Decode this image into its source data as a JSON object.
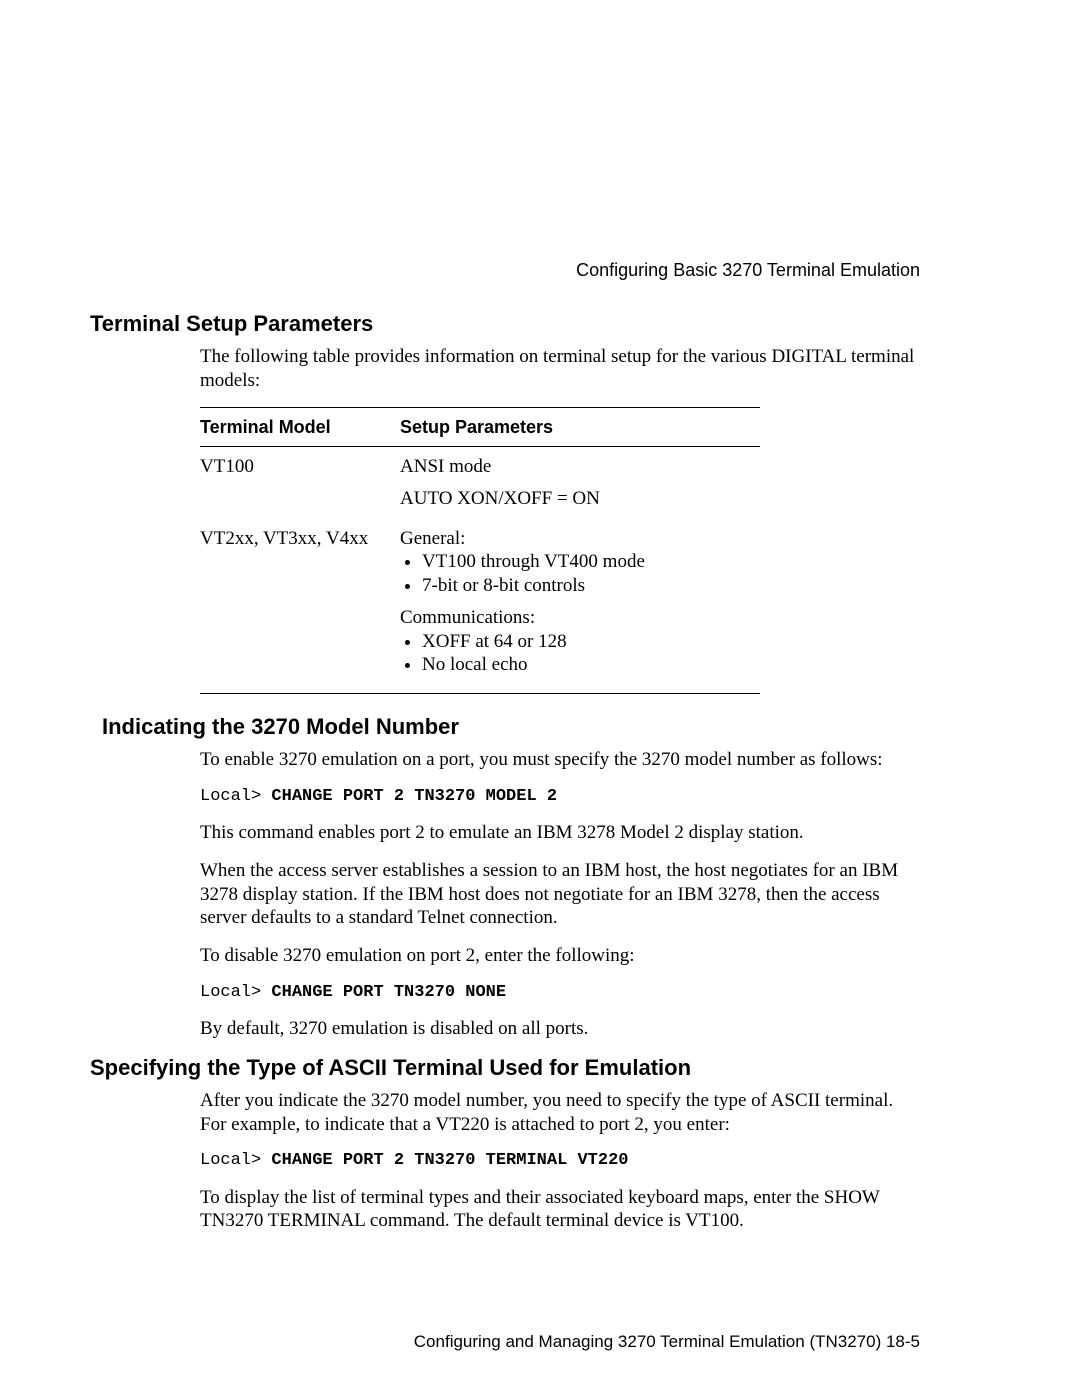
{
  "running_head": "Configuring Basic 3270 Terminal Emulation",
  "sections": {
    "setup": {
      "title": "Terminal Setup Parameters",
      "intro": "The following table provides information on terminal setup for the various DIGITAL terminal models:",
      "table": {
        "headers": {
          "model": "Terminal Model",
          "params": "Setup Parameters"
        },
        "rows": {
          "r0": {
            "model": "VT100",
            "line1": "ANSI mode",
            "line2": "AUTO XON/XOFF = ON"
          },
          "r1": {
            "model": "VT2xx, VT3xx, V4xx",
            "general_label": "General:",
            "general_items": {
              "i0": "VT100 through VT400 mode",
              "i1": "7-bit or 8-bit controls"
            },
            "comm_label": "Communications:",
            "comm_items": {
              "i0": "XOFF at 64 or 128",
              "i1": "No local echo"
            }
          }
        }
      }
    },
    "model": {
      "title": "Indicating the 3270 Model Number",
      "p1": "To enable 3270 emulation on a port, you must specify the 3270 model number as follows:",
      "cmd1_prompt": "Local> ",
      "cmd1_bold": "CHANGE PORT 2 TN3270 MODEL 2",
      "p2": "This command enables port 2 to emulate an IBM 3278 Model 2 display station.",
      "p3": "When the access server establishes a session to an IBM host, the host negotiates for an IBM 3278 display station. If the IBM host does not negotiate for an IBM 3278, then the access server defaults to a standard Telnet connection.",
      "p4": "To disable 3270 emulation on port 2, enter the following:",
      "cmd2_prompt": "Local> ",
      "cmd2_bold": "CHANGE PORT TN3270 NONE",
      "p5": "By default, 3270 emulation is disabled on all ports."
    },
    "ascii": {
      "title": "Specifying the Type of ASCII Terminal Used for Emulation",
      "p1": "After you indicate the 3270 model number, you need to specify the type of ASCII terminal. For example, to indicate that a VT220 is attached to port 2, you enter:",
      "cmd1_prompt": "Local> ",
      "cmd1_bold": "CHANGE PORT 2 TN3270 TERMINAL VT220",
      "p2": "To display the list of terminal types and their associated keyboard maps, enter the SHOW TN3270 TERMINAL command. The default terminal device is VT100."
    }
  },
  "footer": "Configuring and Managing 3270 Terminal Emulation (TN3270) 18-5"
}
